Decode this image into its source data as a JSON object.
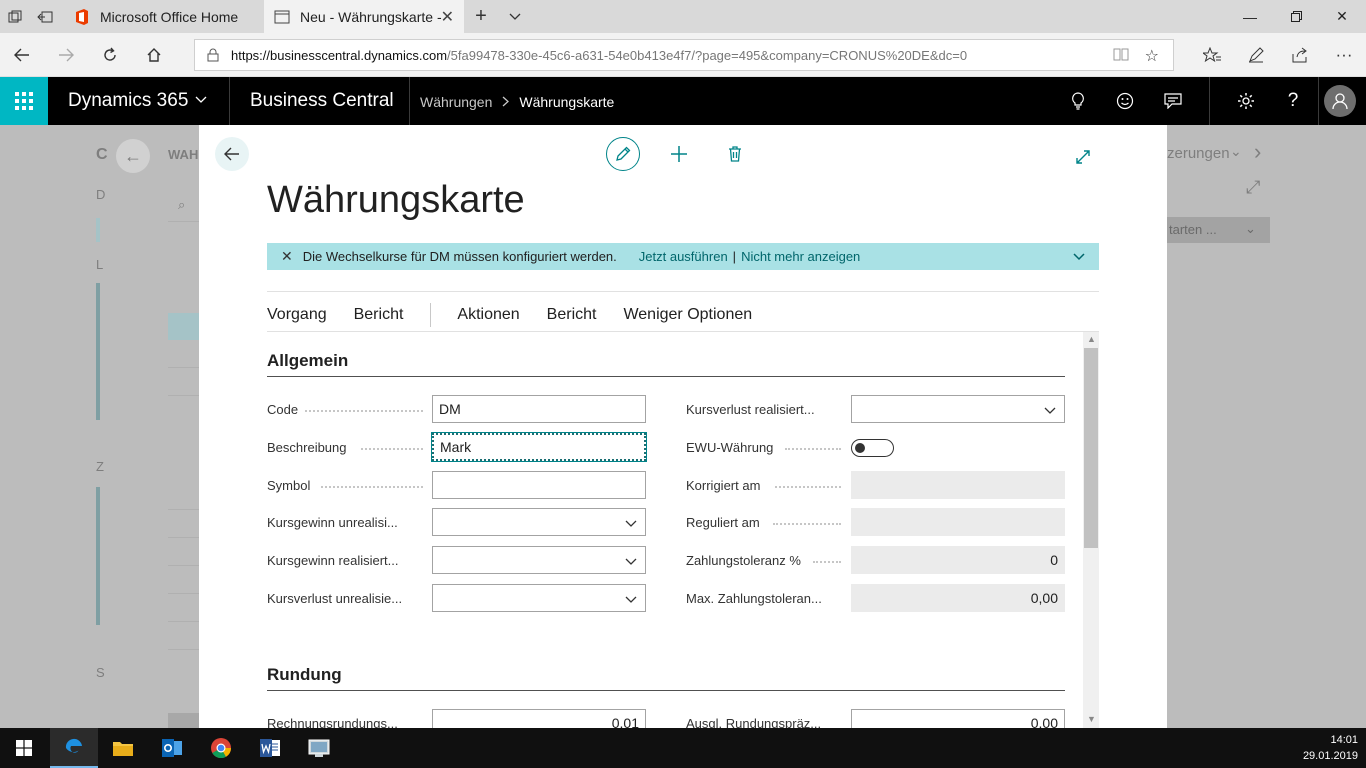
{
  "browser": {
    "tabs": [
      {
        "label": "Microsoft Office Home"
      },
      {
        "label": "Neu - Währungskarte -"
      }
    ],
    "url_host": "https://businesscentral.dynamics.com",
    "url_rest": "/5fa99478-330e-45c6-a631-54e0b413e4f7/?page=495&company=CRONUS%20DE&dc=0"
  },
  "header": {
    "brand": "Dynamics 365",
    "product": "Business Central",
    "breadcrumb_parent": "Währungen",
    "breadcrumb_current": "Währungskarte"
  },
  "background": {
    "title_fragment": "WAH",
    "letters": [
      "C",
      "D",
      "L",
      "Z",
      "S"
    ],
    "right_action": "zerungen",
    "right_dropdown": "tarten ..."
  },
  "dialog": {
    "title": "Währungskarte",
    "notification": {
      "message": "Die Wechselkurse für DM müssen konfiguriert werden.",
      "link_run": "Jetzt ausführen",
      "separator": "|",
      "link_dismiss": "Nicht mehr anzeigen"
    },
    "actions": [
      "Vorgang",
      "Bericht",
      "Aktionen",
      "Bericht",
      "Weniger Optionen"
    ],
    "sections": {
      "general": "Allgemein",
      "rounding": "Rundung"
    },
    "left_fields": [
      {
        "label": "Code",
        "value": "DM"
      },
      {
        "label": "Beschreibung",
        "value": "Mark"
      },
      {
        "label": "Symbol",
        "value": ""
      },
      {
        "label": "Kursgewinn unrealisi...",
        "value": ""
      },
      {
        "label": "Kursgewinn realisiert...",
        "value": ""
      },
      {
        "label": "Kursverlust unrealisie...",
        "value": ""
      }
    ],
    "right_fields": [
      {
        "label": "Kursverlust realisiert...",
        "value": ""
      },
      {
        "label": "EWU-Währung",
        "value": false
      },
      {
        "label": "Korrigiert am",
        "value": ""
      },
      {
        "label": "Reguliert am",
        "value": ""
      },
      {
        "label": "Zahlungstoleranz %",
        "value": "0"
      },
      {
        "label": "Max. Zahlungstoleran...",
        "value": "0,00"
      }
    ],
    "rounding_fields": [
      {
        "label": "Rechnungsrundungs...",
        "value": "0,01"
      },
      {
        "label": "Ausgl. Rundungspräz...",
        "value": "0,00"
      }
    ]
  },
  "taskbar": {
    "time": "14:01",
    "date": "29.01.2019"
  },
  "colors": {
    "accent": "#00b7c3",
    "teal_dark": "#008489",
    "notification_bg": "#a9e1e5",
    "link": "#00666b"
  }
}
